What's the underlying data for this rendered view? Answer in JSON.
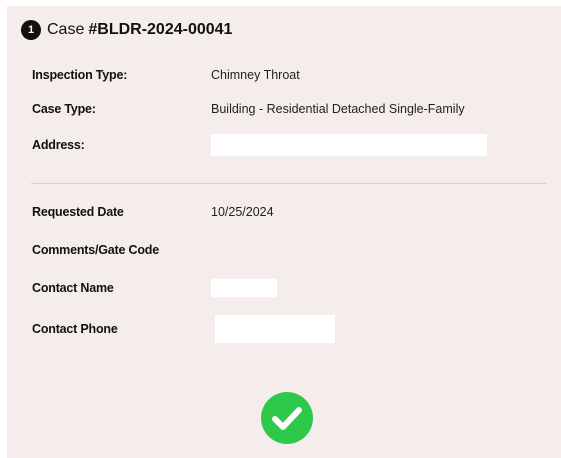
{
  "header": {
    "step_number": "1",
    "case_word": "Case",
    "case_number": "#BLDR-2024-00041"
  },
  "fields": {
    "inspection_type": {
      "label": "Inspection Type:",
      "value": "Chimney Throat"
    },
    "case_type": {
      "label": "Case Type:",
      "value": "Building - Residential Detached Single-Family"
    },
    "address": {
      "label": "Address:",
      "value": ""
    },
    "requested_date": {
      "label": "Requested Date",
      "value": "10/25/2024"
    },
    "comments": {
      "label": "Comments/Gate Code",
      "value": ""
    },
    "contact_name": {
      "label": "Contact Name",
      "value": ""
    },
    "contact_phone": {
      "label": "Contact Phone",
      "value": ""
    }
  },
  "status": {
    "icon": "check-circle-icon",
    "color": "#2ec94a"
  },
  "colors": {
    "card_background": "#f5edeb",
    "text": "#111111",
    "badge": "#111111"
  }
}
